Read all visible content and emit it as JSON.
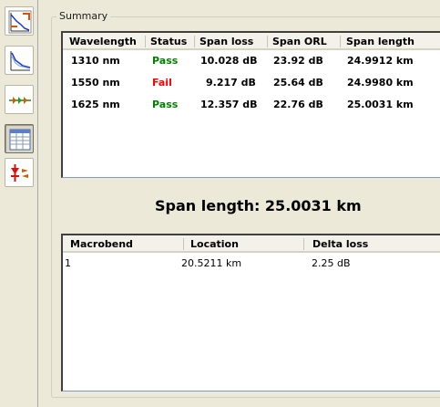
{
  "toolbar": {
    "buttons": [
      {
        "icon": "trace-view-icon",
        "active": false
      },
      {
        "icon": "trace-graph-icon",
        "active": false
      },
      {
        "icon": "link-view-icon",
        "active": false
      },
      {
        "icon": "summary-table-icon",
        "active": true
      },
      {
        "icon": "event-marker-icon",
        "active": false
      }
    ]
  },
  "summary": {
    "title": "Summary",
    "columns": [
      "Wavelength",
      "Status",
      "Span loss",
      "Span ORL",
      "Span length"
    ],
    "rows": [
      {
        "wavelength": "1310 nm",
        "status": "Pass",
        "span_loss": "10.028 dB",
        "span_orl": "23.92 dB",
        "span_length": "24.9912 km"
      },
      {
        "wavelength": "1550 nm",
        "status": "Fail",
        "span_loss": "9.217 dB",
        "span_orl": "25.64 dB",
        "span_length": "24.9980 km"
      },
      {
        "wavelength": "1625 nm",
        "status": "Pass",
        "span_loss": "12.357 dB",
        "span_orl": "22.76 dB",
        "span_length": "25.0031 km"
      }
    ],
    "span_length_text": "Span length: 25.0031 km"
  },
  "macrobend": {
    "columns": [
      "Macrobend",
      "Location",
      "Delta loss"
    ],
    "rows": [
      {
        "macrobend": "1",
        "location": "20.5211 km",
        "delta_loss": "2.25 dB"
      }
    ]
  },
  "colors": {
    "pass": "#008000",
    "fail": "#ff0000",
    "background": "#ece9d8"
  }
}
